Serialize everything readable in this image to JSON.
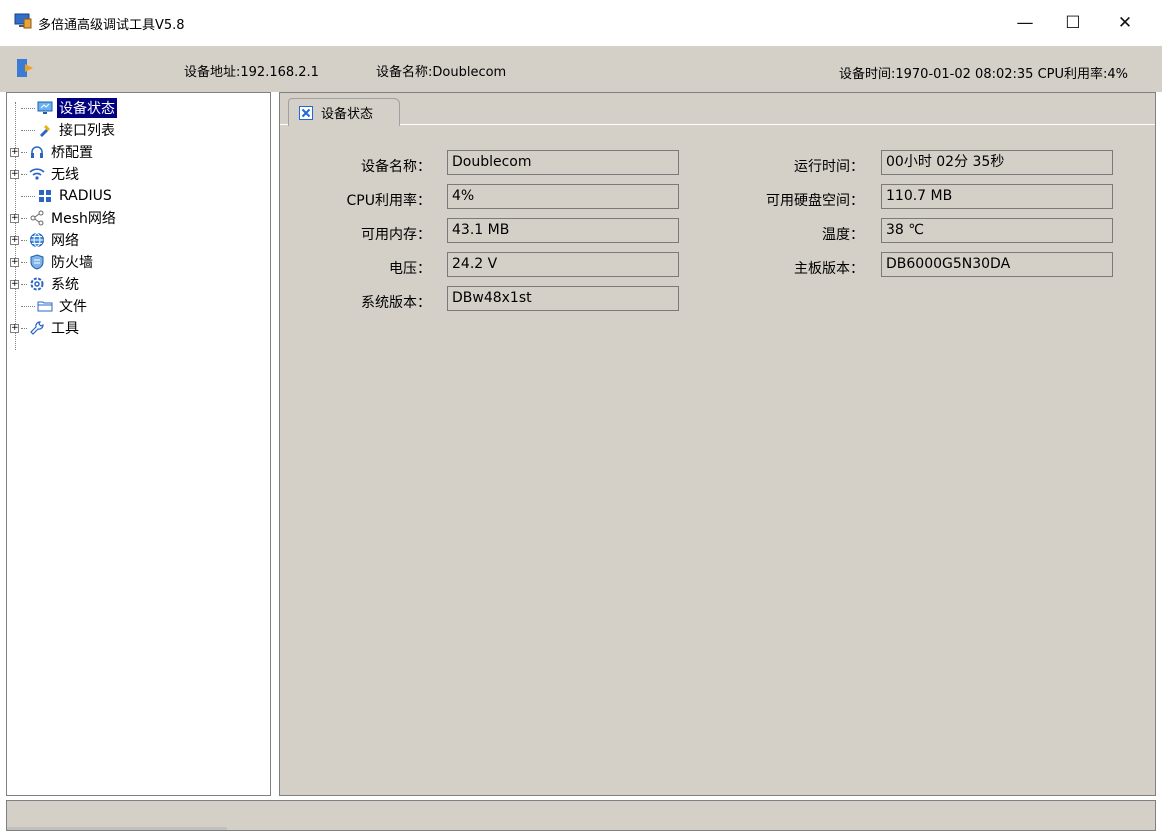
{
  "window": {
    "title": "多倍通高级调试工具V5.8",
    "icon": "monitor-app-icon",
    "minimize": "—",
    "maximize": "☐",
    "close": "✕"
  },
  "info": {
    "address": "设备地址:192.168.2.1",
    "name": "设备名称:Doublecom",
    "time_cpu": "设备时间:1970-01-02 08:02:35 CPU利用率:4%"
  },
  "tree": {
    "items": [
      {
        "label": "设备状态",
        "icon": "monitor-icon",
        "expandable": false,
        "selected": true
      },
      {
        "label": "接口列表",
        "icon": "plug-icon",
        "expandable": false
      },
      {
        "label": "桥配置",
        "icon": "headset-icon",
        "expandable": true
      },
      {
        "label": "无线",
        "icon": "wifi-icon",
        "expandable": true
      },
      {
        "label": "RADIUS",
        "icon": "grid-icon",
        "expandable": false
      },
      {
        "label": "Mesh网络",
        "icon": "share-icon",
        "expandable": true
      },
      {
        "label": "网络",
        "icon": "globe-icon",
        "expandable": true
      },
      {
        "label": "防火墙",
        "icon": "shield-icon",
        "expandable": true
      },
      {
        "label": "系统",
        "icon": "gear-icon",
        "expandable": true
      },
      {
        "label": "文件",
        "icon": "folder-icon",
        "expandable": false
      },
      {
        "label": "工具",
        "icon": "wrench-icon",
        "expandable": true
      }
    ]
  },
  "tab": {
    "label": "设备状态",
    "close_icon": "close-icon"
  },
  "status": {
    "left": [
      {
        "label": "设备名称：",
        "value": "Doublecom"
      },
      {
        "label": "CPU利用率：",
        "value": "4%"
      },
      {
        "label": "可用内存：",
        "value": "43.1 MB"
      },
      {
        "label": "电压：",
        "value": "24.2 V"
      },
      {
        "label": "系统版本：",
        "value": "DBw48x1st"
      }
    ],
    "right": [
      {
        "label": "运行时间：",
        "value": "00小时 02分 35秒"
      },
      {
        "label": "可用硬盘空间：",
        "value": "110.7 MB"
      },
      {
        "label": "温度：",
        "value": "38 ℃"
      },
      {
        "label": "主板版本：",
        "value": "DB6000G5N30DA"
      }
    ]
  },
  "colors": {
    "accent": "#000080",
    "panel": "#d4d0c8",
    "tab_close": "#1e6ad6"
  }
}
